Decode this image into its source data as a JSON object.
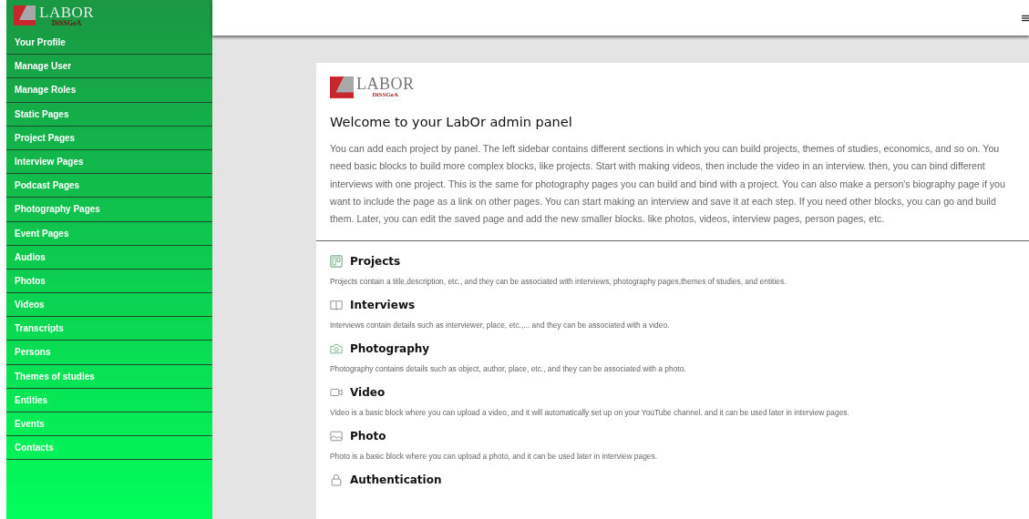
{
  "sidebar": {
    "logo": {
      "name": "LABOR",
      "sub": "DiSSGeA"
    },
    "items": [
      {
        "label": "Your Profile"
      },
      {
        "label": "Manage User"
      },
      {
        "label": "Manage Roles"
      },
      {
        "label": "Static Pages"
      },
      {
        "label": "Project Pages"
      },
      {
        "label": "Interview Pages"
      },
      {
        "label": "Podcast Pages"
      },
      {
        "label": "Photography Pages"
      },
      {
        "label": "Event Pages"
      },
      {
        "label": "Audios"
      },
      {
        "label": "Photos"
      },
      {
        "label": "Videos"
      },
      {
        "label": "Transcripts"
      },
      {
        "label": "Persons"
      },
      {
        "label": "Themes of studies"
      },
      {
        "label": "Entities"
      },
      {
        "label": "Events"
      },
      {
        "label": "Contacts"
      }
    ]
  },
  "card": {
    "logo": {
      "name": "LABOR",
      "sub": "DiSSGeA"
    },
    "title": "Welcome to your LabOr admin panel",
    "intro": "You can add each project by panel. The left sidebar contains different sections in which you can build projects, themes of studies, economics, and so on. You need basic blocks to build more complex blocks, like projects. Start with making videos, then include the video in an interview. then, you can bind different interviews with one project. This is the same for photography pages you can build and bind with a project. You can also make a person's biography page if you want to include the page as a link on other pages. You can start making an interview and save it at each step. If you need other blocks, you can go and build them. Later, you can edit the saved page and add the new smaller blocks. like photos, videos, interview pages, person pages, etc.",
    "sections": [
      {
        "kind": "board",
        "title": "Projects",
        "text": "Projects contain a title,description, etc., and they can be associated with interviews, photography pages,themes of studies, and entities."
      },
      {
        "kind": "book",
        "title": "Interviews",
        "text": "Interviews contain details such as interviewer, place, etc.,... and they can be associated with a video."
      },
      {
        "kind": "camera",
        "title": "Photography",
        "text": "Photography contains details such as object, author, place, etc., and they can be associated with a photo."
      },
      {
        "kind": "video",
        "title": "Video",
        "text": "Video is a basic block where you can upload a video, and it will automatically set up on your YouTube channel. and it can be used later in interview pages."
      },
      {
        "kind": "image",
        "title": "Photo",
        "text": "Photo is a basic block where you can upload a photo, and it can be used later in interview pages."
      },
      {
        "kind": "lock",
        "title": "Authentication"
      }
    ]
  }
}
